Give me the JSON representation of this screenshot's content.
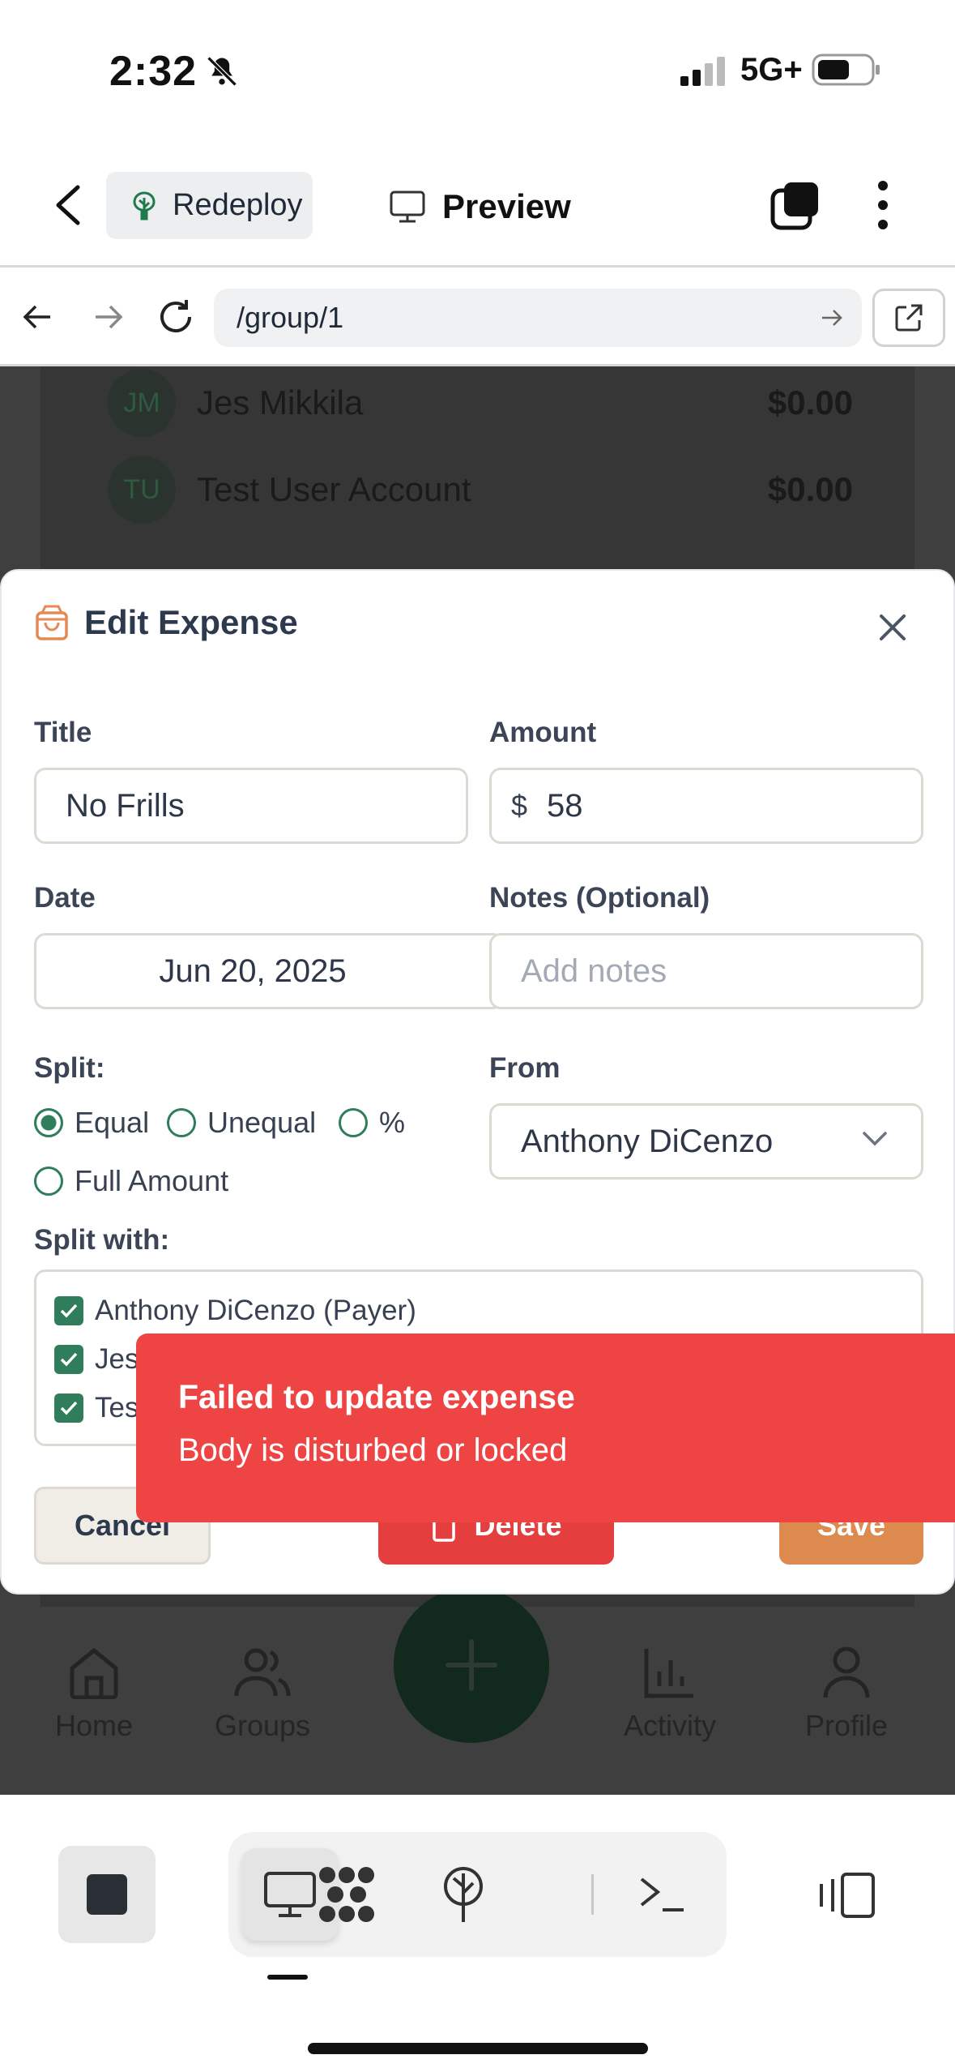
{
  "status_bar": {
    "time": "2:32",
    "network": "5G+"
  },
  "header": {
    "redeploy_label": "Redeploy",
    "preview_label": "Preview"
  },
  "url_bar": {
    "path": "/group/1"
  },
  "background_members": [
    {
      "initials": "JM",
      "name": "Jes Mikkila",
      "amount": "$0.00"
    },
    {
      "initials": "TU",
      "name": "Test User Account",
      "amount": "$0.00"
    }
  ],
  "modal": {
    "title": "Edit Expense",
    "title_label": "Title",
    "title_value": "No Frills",
    "amount_label": "Amount",
    "currency_symbol": "$",
    "amount_value": "58",
    "date_label": "Date",
    "date_value": "Jun 20, 2025",
    "notes_label": "Notes (Optional)",
    "notes_placeholder": "Add notes",
    "split_label": "Split:",
    "split_options": [
      "Equal",
      "Unequal",
      "%",
      "Full Amount"
    ],
    "split_selected": "Equal",
    "from_label": "From",
    "from_value": "Anthony DiCenzo",
    "split_with_label": "Split with:",
    "split_with": [
      "Anthony DiCenzo (Payer)",
      "Jes Mikkila",
      "Test User Account"
    ],
    "cancel_label": "Cancel",
    "delete_label": "Delete",
    "save_label": "Save"
  },
  "toast": {
    "title": "Failed to update expense",
    "message": "Body is disturbed or locked"
  },
  "app_nav": {
    "home": "Home",
    "groups": "Groups",
    "activity": "Activity",
    "profile": "Profile"
  },
  "colors": {
    "primary_green": "#2f7d5b",
    "danger": "#e53e3e",
    "toast": "#ef4444",
    "save": "#dd8a4f",
    "icon_orange": "#e58a55"
  }
}
